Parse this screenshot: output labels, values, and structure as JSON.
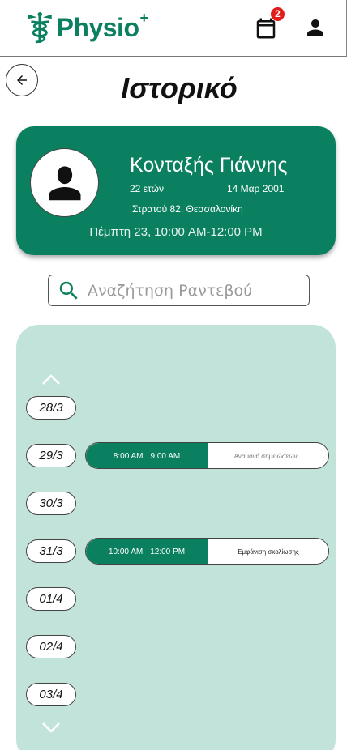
{
  "header": {
    "brand_name": "Physio",
    "brand_plus": "+",
    "notification_count": "2",
    "icons": {
      "logo": "caduceus-icon",
      "calendar": "calendar-icon",
      "profile": "person-icon"
    }
  },
  "page": {
    "title": "Ιστορικό"
  },
  "patient": {
    "name": "Κονταξής Γιάννης",
    "age": "22 ετών",
    "birthdate": "14 Μαρ 2001",
    "address": "Στρατού 82, Θεσσαλονίκη",
    "next_appointment": "Πέμπτη 23, 10:00 AM-12:00 PM"
  },
  "search": {
    "placeholder": "Αναζήτηση Ραντεβού",
    "value": ""
  },
  "history": {
    "dates": [
      "28/3",
      "29/3",
      "30/3",
      "31/3",
      "01/4",
      "02/4",
      "03/4"
    ],
    "appointments": [
      {
        "start": "8:00 AM",
        "end": "9:00 AM",
        "note": "Αναμονή σημειώσεων..."
      },
      {
        "start": "10:00 AM",
        "end": "12:00 PM",
        "note": "Εμφάνιση σκολίωσης"
      }
    ]
  },
  "colors": {
    "brand_green": "#0a8060",
    "panel_bg": "#c2e3da",
    "badge_red": "#e21b1b"
  }
}
